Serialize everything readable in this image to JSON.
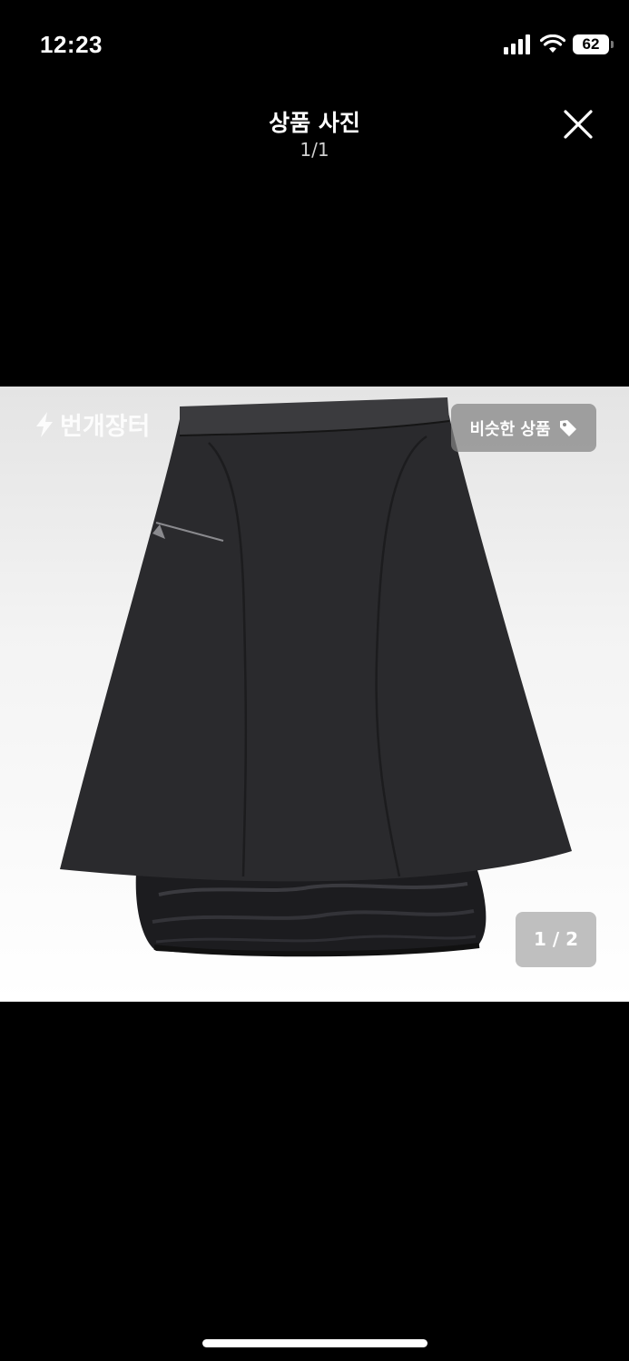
{
  "status_bar": {
    "time": "12:23",
    "battery_level": "62",
    "icons": [
      "signal-icon",
      "wifi-icon",
      "battery-icon"
    ]
  },
  "header": {
    "title": "상품 사진",
    "counter": "1/1",
    "close_icon": "close-icon"
  },
  "photo": {
    "watermark_text": "번개장터",
    "watermark_icon": "lightning-icon",
    "similar_button_label": "비슷한 상품",
    "similar_button_icon": "tag-icon",
    "photo_counter": "1 / 2",
    "subject": "skirt-image"
  },
  "colors": {
    "background": "#000000",
    "overlay_button": "#828282",
    "skirt": "#2a2a2d"
  }
}
